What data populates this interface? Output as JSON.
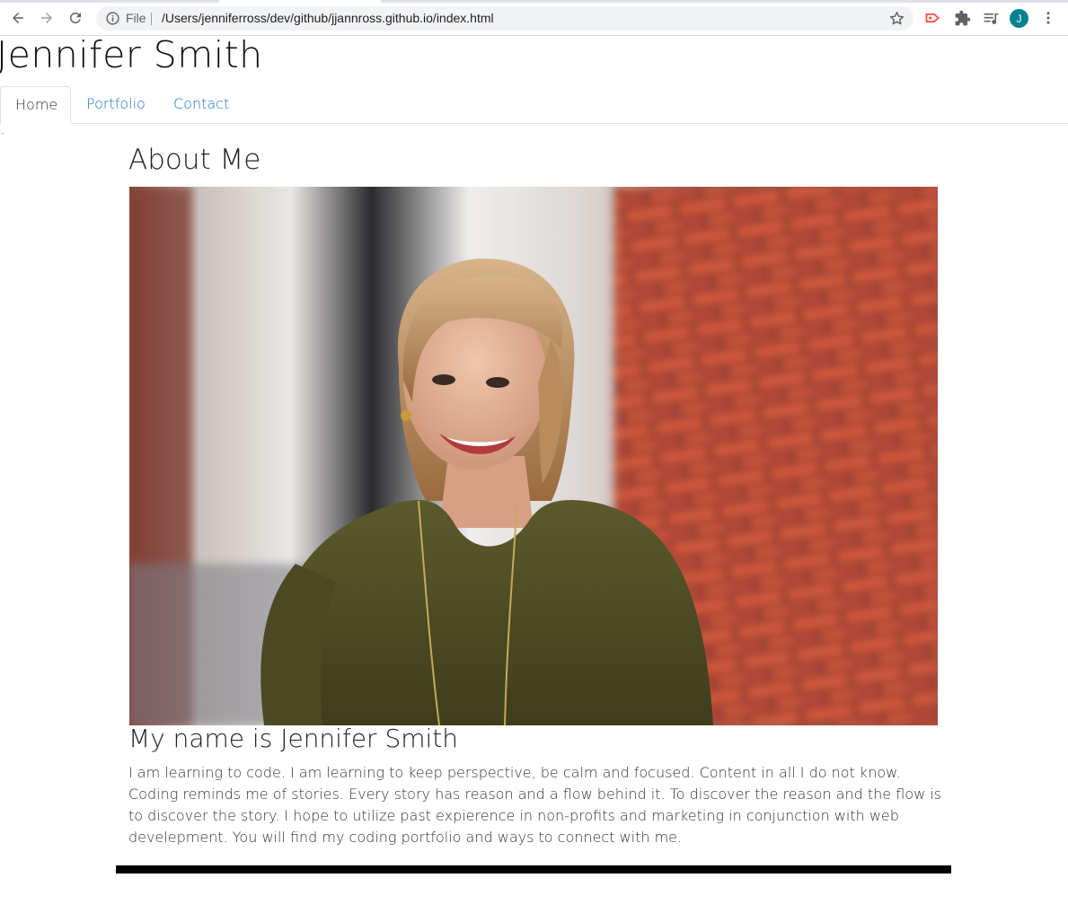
{
  "browser": {
    "url_scheme_label": "File",
    "url": "/Users/jenniferross/dev/github/jjannross.github.io/index.html",
    "profile_initial": "J",
    "accent": "#00838f"
  },
  "site": {
    "title": "Jennifer Smith",
    "nav": [
      {
        "label": "Home",
        "active": true
      },
      {
        "label": "Portfolio",
        "active": false
      },
      {
        "label": "Contact",
        "active": false
      }
    ],
    "link_color": "#1a73c9"
  },
  "about": {
    "heading": "About Me",
    "photo_subject": "Portrait of a smiling woman with shoulder-length blonde hair in an olive green top in front of a red brick wall",
    "name_heading": "My name is Jennifer Smith",
    "bio": "I am learning to code. I am learning to keep perspective, be calm and focused. Content in all I do not know. Coding reminds me of stories. Every story has reason and a flow behind it. To discover the reason and the flow is to discover the story. I hope to utilize past expierence in non-profits and marketing in conjunction with web develepment. You will find my coding portfolio and ways to connect with me."
  }
}
